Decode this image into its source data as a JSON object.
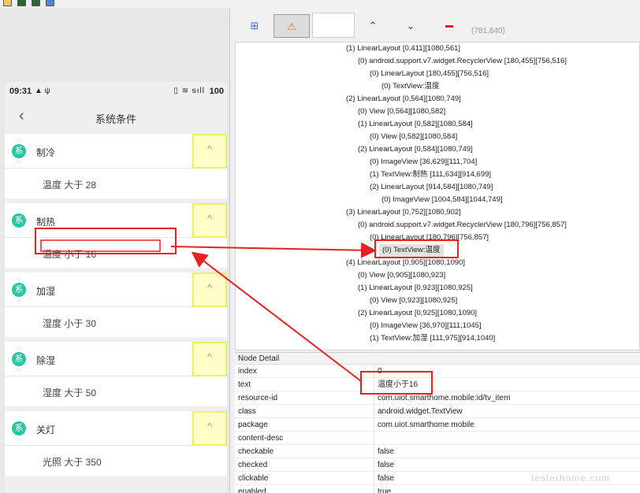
{
  "status": {
    "time": "09:31",
    "left_icons": "▲ ψ",
    "right_icons": "▯ ≋ ᵴıll",
    "battery": "100"
  },
  "nav": {
    "back_icon": "‹",
    "title": "系统条件"
  },
  "groups": [
    {
      "icon_char": "系",
      "label": "制冷",
      "item": "温度 大于 28"
    },
    {
      "icon_char": "系",
      "label": "制热",
      "item": "温度 小于 16"
    },
    {
      "icon_char": "系",
      "label": "加湿",
      "item": "湿度 小于 30"
    },
    {
      "icon_char": "系",
      "label": "除湿",
      "item": "湿度 大于 50"
    },
    {
      "icon_char": "系",
      "label": "关灯",
      "item": "光照 大于 350"
    }
  ],
  "toggle_icon": "^",
  "toolbar": {
    "expand_icon": "⊞",
    "warn_icon": "⚠",
    "up_icon": "⌃",
    "down_icon": "⌄",
    "coords": "(781,840)"
  },
  "tree_rows": [
    "(1) LinearLayout [0,411][1080,561]",
    "(0) android.support.v7.widget.RecyclerView [180,455][756,516]",
    "(0) LinearLayout [180,455][756,516]",
    "(0) TextView:温度",
    "(2) LinearLayout [0,564][1080,749]",
    "(0) View [0,564][1080,582]",
    "(1) LinearLayout [0,582][1080,584]",
    "(0) View [0,582][1080,584]",
    "(2) LinearLayout [0,584][1080,749]",
    "(0) ImageView [36,629][111,704]",
    "(1) TextView:制热 [111,634][914,699]",
    "(2) LinearLayout [914,584][1080,749]",
    "(0) ImageView [1004,584][1044,749]",
    "(3) LinearLayout [0,752][1080,902]",
    "(0) android.support.v7.widget.RecyclerView [180,796][756,857]",
    "(0) LinearLayout [180,796][756,857]",
    "(0) TextView:温度",
    "(4) LinearLayout [0,905][1080,1090]",
    "(0) View [0,905][1080,923]",
    "(1) LinearLayout [0,923][1080,925]",
    "(0) View [0,923][1080,925]",
    "(2) LinearLayout [0,925][1080,1090]",
    "(0) ImageView [36,970][111,1045]",
    "(1) TextView:加湿 [111,975][914,1040]"
  ],
  "detail": {
    "header": "Node Detail",
    "rows": [
      {
        "key": "index",
        "value": "0"
      },
      {
        "key": "text",
        "value": "温度小于16"
      },
      {
        "key": "resource-id",
        "value": "com.uiot.smarthome.mobile:id/tv_item"
      },
      {
        "key": "class",
        "value": "android.widget.TextView"
      },
      {
        "key": "package",
        "value": "com.uiot.smarthome.mobile"
      },
      {
        "key": "content-desc",
        "value": ""
      },
      {
        "key": "checkable",
        "value": "false"
      },
      {
        "key": "checked",
        "value": "false"
      },
      {
        "key": "clickable",
        "value": "false"
      },
      {
        "key": "enabled",
        "value": "true"
      }
    ]
  },
  "watermark": "testerhome.com",
  "colors": {
    "accent": "#26c6a0",
    "highlight": "#ffffc8",
    "annotation": "#e82020"
  }
}
